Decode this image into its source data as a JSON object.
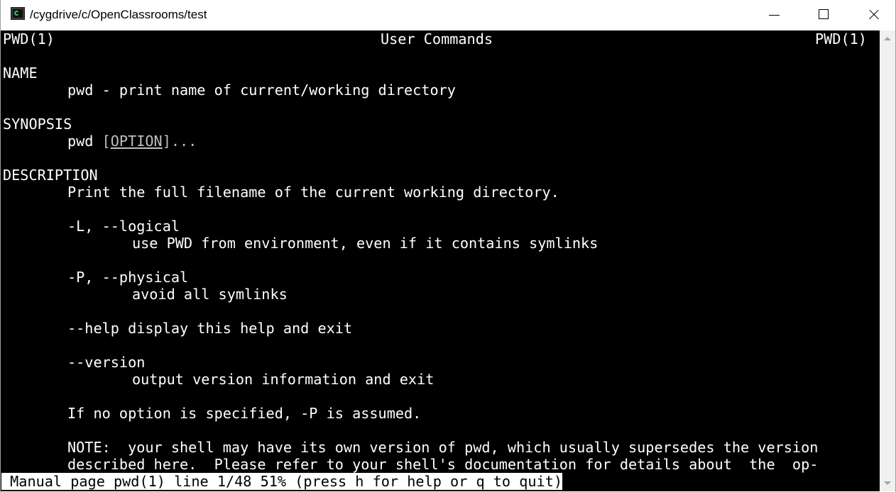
{
  "window": {
    "title": "/cygdrive/c/OpenClassrooms/test",
    "icon": "terminal-icon"
  },
  "controls": {
    "minimize_icon": "minimize-icon",
    "maximize_icon": "maximize-icon",
    "close_icon": "close-icon"
  },
  "man": {
    "header_left": "PWD(1)",
    "header_center": "User Commands",
    "header_right": "PWD(1)",
    "name_heading": "NAME",
    "name_text": "pwd - print name of current/working directory",
    "synopsis_heading": "SYNOPSIS",
    "synopsis_cmd": "pwd",
    "synopsis_bracket_open": "[",
    "synopsis_option": "OPTION",
    "synopsis_rest": "]...",
    "description_heading": "DESCRIPTION",
    "description_text": "Print the full filename of the current working directory.",
    "opt_logical": "-L, --logical",
    "opt_logical_desc": "use PWD from environment, even if it contains symlinks",
    "opt_physical": "-P, --physical",
    "opt_physical_desc": "avoid all symlinks",
    "opt_help": "--help",
    "opt_help_desc": "display this help and exit",
    "opt_version": "--version",
    "opt_version_desc": "output version information and exit",
    "default_note": "If no option is specified, -P is assumed.",
    "note_line1": "NOTE:  your shell may have its own version of pwd, which usually supersedes the version",
    "note_line2": "described here.  Please refer to your shell's documentation for details about  the  op-"
  },
  "status": {
    "text": " Manual page pwd(1) line 1/48 51% (press h for help or q to quit)"
  },
  "scrollbar": {
    "up_icon": "scroll-up-arrow-icon",
    "down_icon": "scroll-down-arrow-icon"
  }
}
